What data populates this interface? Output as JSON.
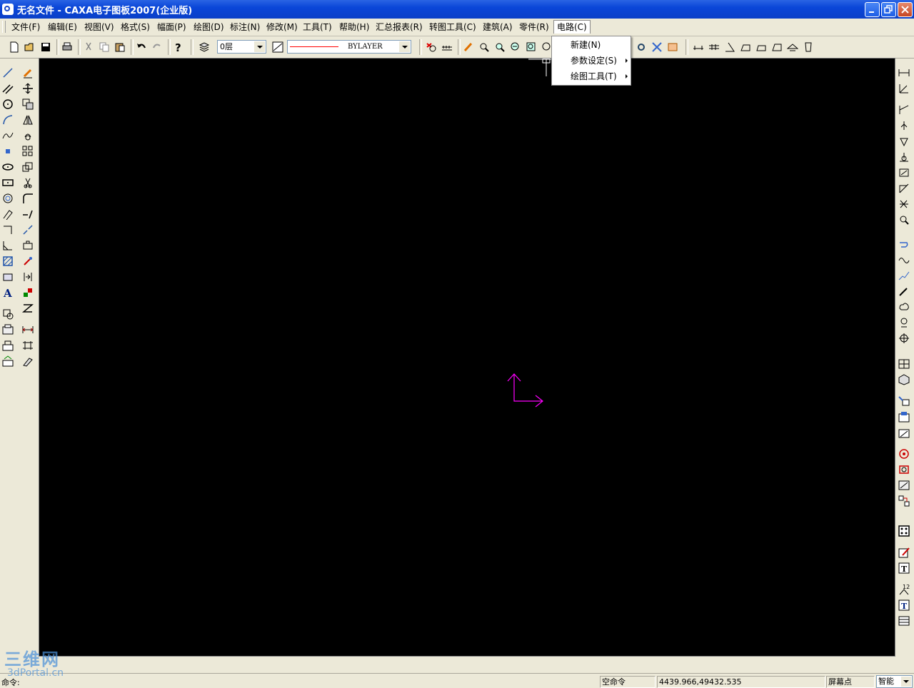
{
  "window": {
    "title": "无名文件 - CAXA电子图板2007(企业版)"
  },
  "menubar": {
    "items": [
      {
        "label": "文件(F)"
      },
      {
        "label": "编辑(E)"
      },
      {
        "label": "视图(V)"
      },
      {
        "label": "格式(S)"
      },
      {
        "label": "幅面(P)"
      },
      {
        "label": "绘图(D)"
      },
      {
        "label": "标注(N)"
      },
      {
        "label": "修改(M)"
      },
      {
        "label": "工具(T)"
      },
      {
        "label": "帮助(H)"
      },
      {
        "label": "汇总报表(R)"
      },
      {
        "label": "转图工具(C)"
      },
      {
        "label": "建筑(A)"
      },
      {
        "label": "零件(R)"
      },
      {
        "label": "电路(C)"
      }
    ]
  },
  "dropdown": {
    "items": [
      {
        "label": "新建(N)",
        "has_submenu": false
      },
      {
        "label": "参数设定(S)",
        "has_submenu": true
      },
      {
        "label": "绘图工具(T)",
        "has_submenu": true
      }
    ]
  },
  "toolbar": {
    "layer_value": "0层",
    "linetype_value": "BYLAYER",
    "line_color": "#ff0000"
  },
  "canvas": {
    "background": "#000000",
    "axis_color": "#ff00ff"
  },
  "command": {
    "label": "命令:"
  },
  "status": {
    "command_state": "空命令",
    "coordinates": "4439.966,49432.535",
    "snap_label": "屏幕点",
    "snap_mode": "智能"
  },
  "watermark": {
    "line1": "三维网",
    "line2": "3dPortal.cn"
  }
}
